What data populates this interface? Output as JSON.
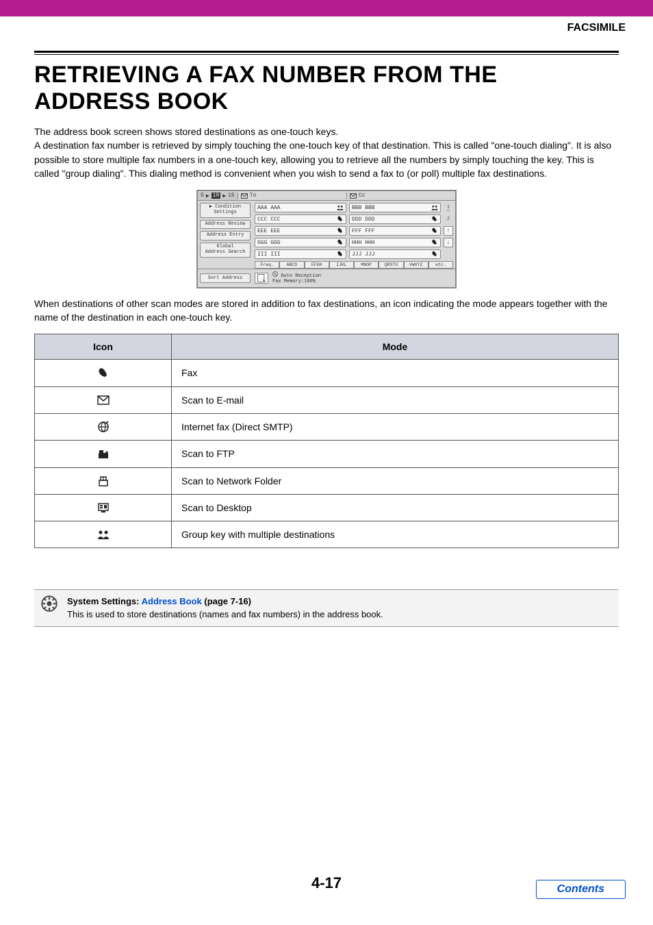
{
  "brand": "FACSIMILE",
  "title": "RETRIEVING A FAX NUMBER FROM THE ADDRESS BOOK",
  "intro": "The address book screen shows stored destinations as one-touch keys.\nA destination fax number is retrieved by simply touching the one-touch key of that destination. This is called \"one-touch dialing\". It is also possible to store multiple fax numbers in a one-touch key, allowing you to retrieve all the numbers by simply touching the key. This is called \"group dialing\". This dialing method is convenient when you wish to send a fax to (or poll) multiple fax destinations.",
  "belowScreen": "When destinations of other scan modes are stored in addition to fax destinations, an icon indicating the mode appears together with the name of the destination in each one-touch key.",
  "screen": {
    "crumb": [
      "5",
      "10",
      "15"
    ],
    "toTab": "To",
    "ccTab": "Cc",
    "sideButtons": [
      {
        "label": "Condition\nSettings",
        "arrow": true
      },
      {
        "label": "Address Review"
      },
      {
        "label": "Address Entry"
      },
      {
        "label": "Global\nAddress Search"
      }
    ],
    "cards": [
      [
        "AAA AAA",
        "BBB BBB"
      ],
      [
        "CCC CCC",
        "DDD DDD"
      ],
      [
        "EEE EEE",
        "FFF FFF"
      ],
      [
        "GGG GGG",
        "HHH HHH"
      ],
      [
        "III III",
        "JJJ JJJ"
      ]
    ],
    "cardIcons": [
      [
        "group",
        "group"
      ],
      [
        "fax",
        "fax"
      ],
      [
        "fax",
        "fax"
      ],
      [
        "fax",
        "fax"
      ],
      [
        "fax",
        "fax"
      ]
    ],
    "pager": {
      "page": "1",
      "total": "2",
      "up": "↑",
      "down": "↓"
    },
    "tabs": [
      "Freq.",
      "ABCD",
      "EFGH",
      "IJKL",
      "MNOP",
      "QRSTU",
      "VWXYZ",
      "etc."
    ],
    "sort": "Sort Address",
    "statusLine1": "Auto Reception",
    "statusLine2": "Fax Memory:100%"
  },
  "table": {
    "headers": [
      "Icon",
      "Mode"
    ],
    "rows": [
      {
        "icon": "fax",
        "label": "Fax"
      },
      {
        "icon": "email",
        "label": "Scan to E-mail"
      },
      {
        "icon": "ifax",
        "label": "Internet fax (Direct SMTP)"
      },
      {
        "icon": "ftp",
        "label": "Scan to FTP"
      },
      {
        "icon": "netfolder",
        "label": "Scan to Network Folder"
      },
      {
        "icon": "desktop",
        "label": "Scan to Desktop"
      },
      {
        "icon": "group",
        "label": "Group key with multiple destinations"
      }
    ]
  },
  "note": {
    "prefix": "System Settings: ",
    "linkText": "Address Book",
    "suffix": " (page 7-16)",
    "body": "This is used to store destinations (names and fax numbers) in the address book."
  },
  "pageNumber": "4-17",
  "contentsLabel": "Contents"
}
